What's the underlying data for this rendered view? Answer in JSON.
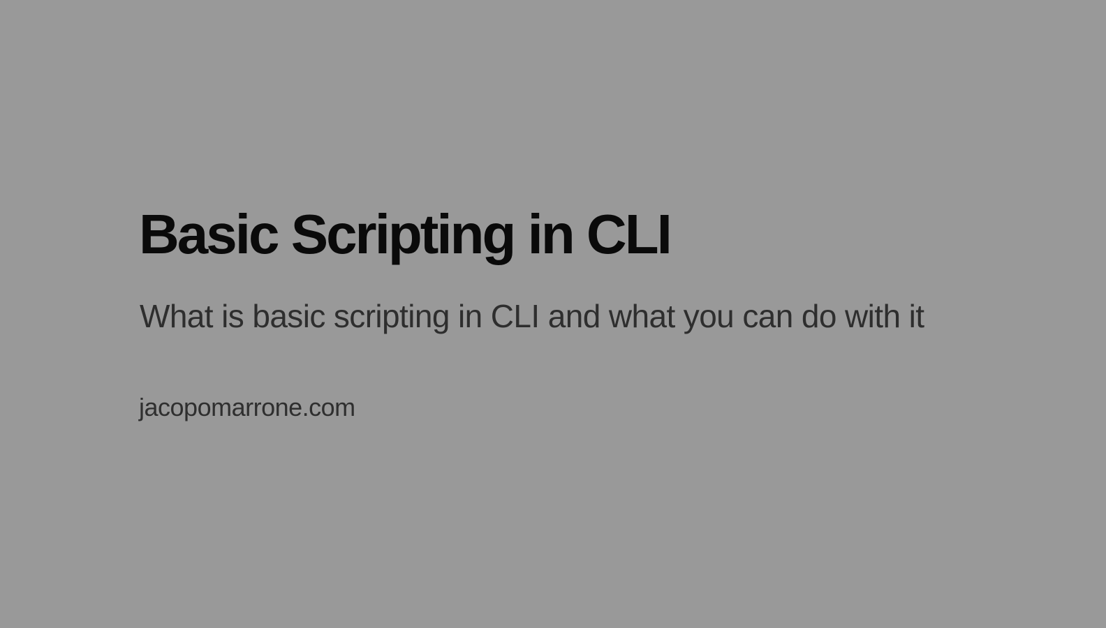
{
  "slide": {
    "title": "Basic Scripting in CLI",
    "subtitle": "What is basic scripting in CLI and what you can do with it",
    "website": "jacopomarrone.com"
  },
  "colors": {
    "background": "#999999",
    "title": "#0a0a0a",
    "subtitle": "#2e2e2e",
    "website": "#2f2f2f"
  }
}
